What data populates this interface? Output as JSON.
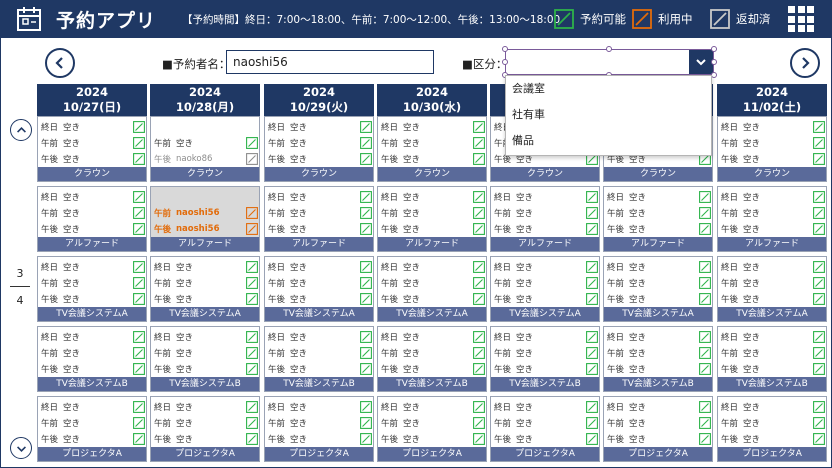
{
  "app": {
    "title": "予約アプリ",
    "hours": "【予約時間】終日：7:00～18:00、午前：7:00～12:00、午後：13:00～18:00"
  },
  "legend": [
    {
      "label": "予約可能",
      "color": "#2db34a"
    },
    {
      "label": "利用中",
      "color": "#e26b0a"
    },
    {
      "label": "返却済",
      "color": "#8c8c8c"
    }
  ],
  "filters": {
    "name_label": "■予約者名：",
    "name_value": "naoshi56",
    "category_label": "■区分：",
    "category_value": "",
    "category_options": [
      "会議室",
      "社有車",
      "備品"
    ]
  },
  "days": [
    {
      "year": "2024",
      "date": "10/27(日)"
    },
    {
      "year": "2024",
      "date": "10/28(月)"
    },
    {
      "year": "2024",
      "date": "10/29(火)"
    },
    {
      "year": "2024",
      "date": "10/30(水)"
    },
    {
      "year": "2024",
      "date": "10/31(木)"
    },
    {
      "year": "2024",
      "date": "11/01(金)"
    },
    {
      "year": "2024",
      "date": "11/02(土)"
    }
  ],
  "rooms": [
    "クラウン",
    "アルファード",
    "TV会議システムA",
    "TV会議システムB",
    "プロジェクタA"
  ],
  "periods": [
    "終日",
    "午前",
    "午後"
  ],
  "slots": {
    "free_status": "空き",
    "overrides": [
      {
        "room": 0,
        "day": 1,
        "slot": 0,
        "status": "",
        "state": "none"
      },
      {
        "room": 0,
        "day": 1,
        "slot": 2,
        "status": "naoko86",
        "state": "returned"
      },
      {
        "room": 1,
        "day": 1,
        "slot": 0,
        "status": "",
        "state": "none"
      },
      {
        "room": 1,
        "day": 1,
        "slot": 1,
        "status": "naoshi56",
        "state": "used"
      },
      {
        "room": 1,
        "day": 1,
        "slot": 2,
        "status": "naoshi56",
        "state": "used"
      }
    ],
    "gray_cells": [
      {
        "room": 1,
        "day": 1
      }
    ]
  },
  "pager": {
    "current": "3",
    "total": "4"
  },
  "colors": {
    "navy": "#1f3864",
    "room_bar": "#5a6a9a",
    "available": "#2db34a",
    "in_use": "#e26b0a",
    "returned": "#8c8c8c"
  }
}
